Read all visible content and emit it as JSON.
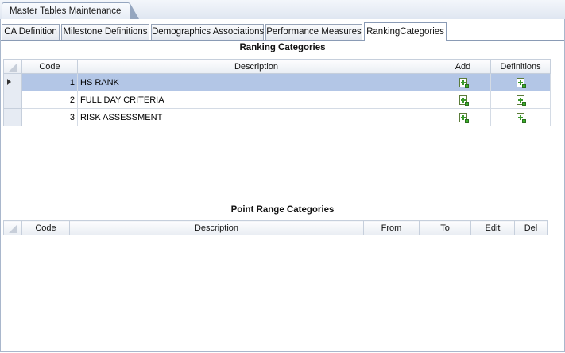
{
  "window": {
    "tab_title": "Master Tables Maintenance"
  },
  "tabs": [
    {
      "label": "CA Definition"
    },
    {
      "label": "Milestone Definitions"
    },
    {
      "label": "Demographics Associations"
    },
    {
      "label": "Performance Measures"
    },
    {
      "label": "RankingCategories"
    }
  ],
  "ranking": {
    "title": "Ranking Categories",
    "columns": {
      "code": "Code",
      "description": "Description",
      "add": "Add",
      "definitions": "Definitions"
    },
    "rows": [
      {
        "code": "1",
        "description": "HS RANK",
        "selected": true
      },
      {
        "code": "2",
        "description": "FULL DAY CRITERIA",
        "selected": false
      },
      {
        "code": "3",
        "description": "RISK ASSESSMENT",
        "selected": false
      }
    ]
  },
  "point_range": {
    "title": "Point Range Categories",
    "columns": {
      "code": "Code",
      "description": "Description",
      "from": "From",
      "to": "To",
      "edit": "Edit",
      "del": "Del"
    }
  },
  "icons": {
    "add": "add-document-icon",
    "definitions": "add-document-icon",
    "row_indicator": "row-selector-arrow-icon"
  },
  "colors": {
    "selected_row": "#b3c6e6",
    "header_gradient_end": "#e9edf3",
    "icon_green": "#3a9a2a"
  }
}
